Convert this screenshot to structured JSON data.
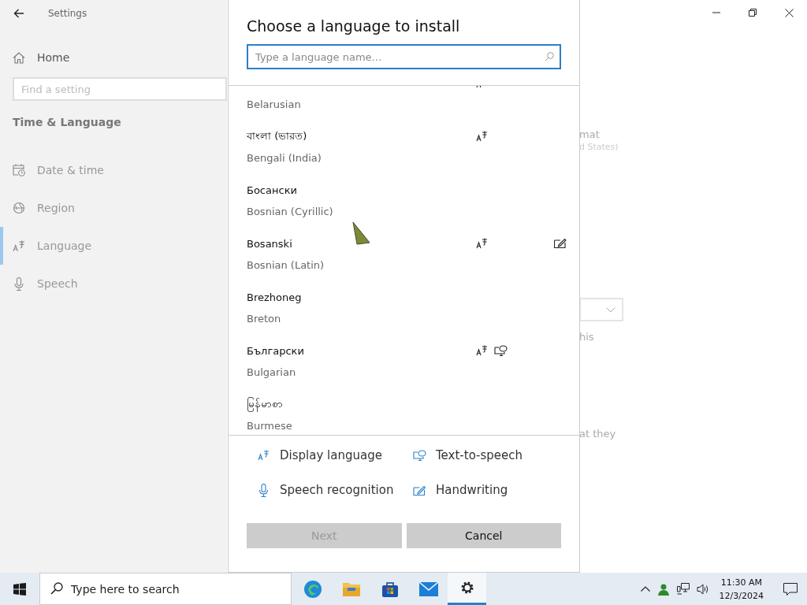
{
  "settings": {
    "title": "Settings",
    "home": "Home",
    "search": {
      "placeholder": "Find a setting"
    },
    "section": "Time & Language",
    "items": [
      {
        "label": "Date & time",
        "kind": "date",
        "selected": false
      },
      {
        "label": "Region",
        "kind": "region",
        "selected": false
      },
      {
        "label": "Language",
        "kind": "language",
        "selected": true
      },
      {
        "label": "Speech",
        "kind": "speech",
        "selected": false
      }
    ],
    "background_text": [
      {
        "kind": "heading",
        "text": "mat"
      },
      {
        "kind": "sub",
        "text": "d States)"
      },
      {
        "kind": "dropdown"
      },
      {
        "kind": "line",
        "text": "his"
      },
      {
        "kind": "line",
        "text": "at they"
      }
    ]
  },
  "dialog": {
    "title": "Choose a language to install",
    "search": {
      "placeholder": "Type a language name..."
    },
    "languages": [
      {
        "name": "Belarusian",
        "display": true,
        "tts": false,
        "speech": false,
        "handwriting": false
      },
      {
        "native": "বাংলা (ভারত)",
        "name": "Bengali (India)",
        "display": true,
        "tts": false,
        "speech": false,
        "handwriting": false
      },
      {
        "native": "Босански",
        "name": "Bosnian (Cyrillic)",
        "display": false,
        "tts": false,
        "speech": false,
        "handwriting": false
      },
      {
        "native": "Bosanski",
        "name": "Bosnian (Latin)",
        "display": true,
        "tts": false,
        "speech": false,
        "handwriting": true
      },
      {
        "native": "Brezhoneg",
        "name": "Breton",
        "display": false,
        "tts": false,
        "speech": false,
        "handwriting": false
      },
      {
        "native": "Български",
        "name": "Bulgarian",
        "display": true,
        "tts": true,
        "speech": false,
        "handwriting": false
      },
      {
        "native": "မြန်မာစာ",
        "name": "Burmese",
        "display": false,
        "tts": false,
        "speech": false,
        "handwriting": false
      }
    ],
    "legend": [
      {
        "kind": "display",
        "label": "Display language"
      },
      {
        "kind": "tts",
        "label": "Text-to-speech"
      },
      {
        "kind": "speech",
        "label": "Speech recognition"
      },
      {
        "kind": "handwriting",
        "label": "Handwriting"
      }
    ],
    "buttons": [
      {
        "label": "Next",
        "disabled": true
      },
      {
        "label": "Cancel",
        "disabled": false
      }
    ]
  },
  "taskbar": {
    "search": {
      "placeholder": "Type here to search"
    },
    "apps": [
      {
        "kind": "edge",
        "selected": false
      },
      {
        "kind": "folder",
        "selected": false
      },
      {
        "kind": "store",
        "selected": false
      },
      {
        "kind": "mail",
        "selected": false
      },
      {
        "kind": "settings",
        "selected": true
      }
    ],
    "time": "11:30 AM",
    "date": "12/3/2024"
  }
}
